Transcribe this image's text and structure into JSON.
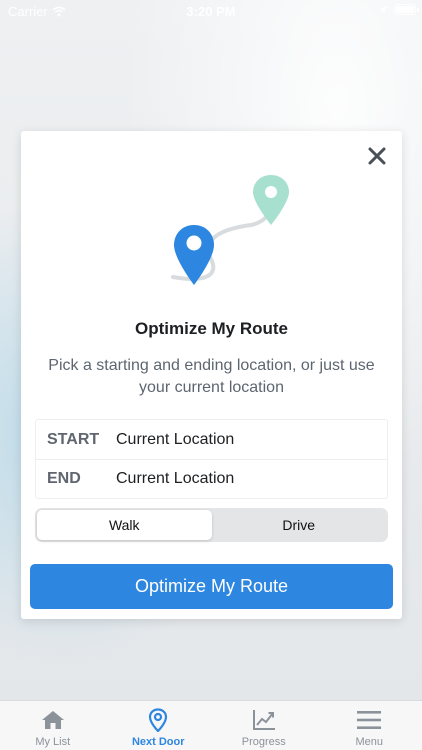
{
  "status_bar": {
    "carrier": "Carrier",
    "time": "3:20 PM"
  },
  "modal": {
    "title": "Optimize My Route",
    "subtitle": "Pick a starting and ending location, or just use your current location",
    "locations": [
      {
        "label": "START",
        "value": "Current Location"
      },
      {
        "label": "END",
        "value": "Current Location"
      }
    ],
    "mode_options": [
      "Walk",
      "Drive"
    ],
    "selected_mode": "Walk",
    "primary_button": "Optimize My Route",
    "colors": {
      "accent": "#2d86e0",
      "start_pin": "#2d86e0",
      "end_pin": "#a8e0cf"
    }
  },
  "tab_bar": {
    "items": [
      {
        "label": "My List",
        "icon": "home-icon"
      },
      {
        "label": "Next Door",
        "icon": "location-pin-icon",
        "active": true
      },
      {
        "label": "Progress",
        "icon": "trend-chart-icon"
      },
      {
        "label": "Menu",
        "icon": "menu-icon"
      }
    ]
  }
}
